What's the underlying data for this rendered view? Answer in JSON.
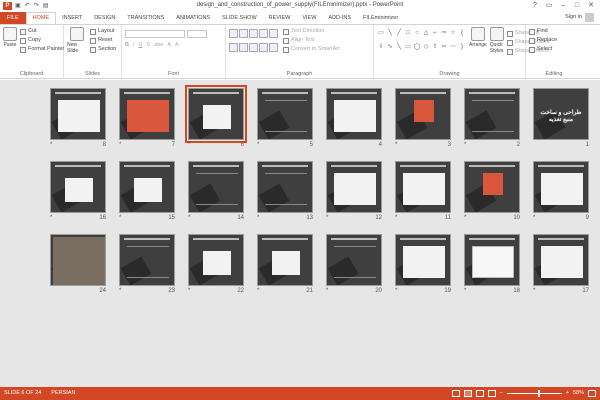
{
  "window": {
    "title": "design_and_construction_of_power_supply(FILEminimizer).pptx - PowerPoint",
    "app_icon": "P",
    "qat": [
      "save-icon",
      "undo-icon",
      "redo-icon",
      "present-icon"
    ],
    "controls": [
      "?",
      "▭",
      "–",
      "□",
      "✕"
    ],
    "signin": "Sign in"
  },
  "tabs": [
    {
      "label": "FILE"
    },
    {
      "label": "HOME"
    },
    {
      "label": "INSERT"
    },
    {
      "label": "DESIGN"
    },
    {
      "label": "TRANSITIONS"
    },
    {
      "label": "ANIMATIONS"
    },
    {
      "label": "SLIDE SHOW"
    },
    {
      "label": "REVIEW"
    },
    {
      "label": "VIEW"
    },
    {
      "label": "ADD-INS"
    },
    {
      "label": "FILEminimizer"
    }
  ],
  "active_tab": "HOME",
  "ribbon": {
    "clipboard": {
      "label": "Clipboard",
      "paste": "Paste",
      "cut": "Cut",
      "copy": "Copy",
      "format_painter": "Format Painter"
    },
    "slides": {
      "label": "Slides",
      "new_slide": "New Slide",
      "layout": "Layout",
      "reset": "Reset",
      "section": "Section"
    },
    "font": {
      "label": "Font",
      "bold": "B",
      "italic": "I",
      "underline": "U",
      "shadow": "S",
      "strike": "abe",
      "grow": "A",
      "clear": "A"
    },
    "paragraph": {
      "label": "Paragraph",
      "text_direction": "Text Direction",
      "align_text": "Align Text",
      "convert_smartart": "Convert to SmartArt"
    },
    "drawing": {
      "label": "Drawing",
      "arrange": "Arrange",
      "quick_styles": "Quick Styles",
      "shape_fill": "Shape Fill",
      "shape_outline": "Shape Outline",
      "shape_effects": "Shape Effects"
    },
    "editing": {
      "label": "Editing",
      "find": "Find",
      "replace": "Replace",
      "select": "Select"
    }
  },
  "slides": [
    {
      "num": "1",
      "star": "",
      "kind": "title",
      "title_text": "طراحی و ساخت منبع تغذیه"
    },
    {
      "num": "2",
      "star": "*",
      "kind": "dark-text"
    },
    {
      "num": "3",
      "star": "*",
      "kind": "orange-block"
    },
    {
      "num": "4",
      "star": "",
      "kind": "light-table"
    },
    {
      "num": "5",
      "star": "*",
      "kind": "dark-diagram"
    },
    {
      "num": "6",
      "star": "*",
      "kind": "light-small",
      "selected": true
    },
    {
      "num": "7",
      "star": "*",
      "kind": "orange-full"
    },
    {
      "num": "8",
      "star": "*",
      "kind": "light-table"
    },
    {
      "num": "9",
      "star": "*",
      "kind": "light-wave"
    },
    {
      "num": "10",
      "star": "*",
      "kind": "orange-block"
    },
    {
      "num": "11",
      "star": "*",
      "kind": "light-table"
    },
    {
      "num": "12",
      "star": "*",
      "kind": "light-wave"
    },
    {
      "num": "13",
      "star": "*",
      "kind": "dark-diagram"
    },
    {
      "num": "14",
      "star": "*",
      "kind": "dark-text"
    },
    {
      "num": "15",
      "star": "*",
      "kind": "light-small"
    },
    {
      "num": "16",
      "star": "*",
      "kind": "light-small"
    },
    {
      "num": "17",
      "star": "*",
      "kind": "light-table"
    },
    {
      "num": "18",
      "star": "*",
      "kind": "white-box"
    },
    {
      "num": "19",
      "star": "*",
      "kind": "light-table"
    },
    {
      "num": "20",
      "star": "*",
      "kind": "dark-diagram"
    },
    {
      "num": "21",
      "star": "*",
      "kind": "light-small"
    },
    {
      "num": "22",
      "star": "*",
      "kind": "light-small"
    },
    {
      "num": "23",
      "star": "*",
      "kind": "dark-text"
    },
    {
      "num": "24",
      "star": "",
      "kind": "photo"
    }
  ],
  "status": {
    "slide_info": "SLIDE 6 OF 24",
    "language": "PERSIAN",
    "zoom": "58%",
    "zoom_fraction": 0.58,
    "minus": "−",
    "plus": "+"
  },
  "colors": {
    "accent": "#d24726",
    "workspace": "#e6e6e6",
    "slide_bg": "#3f3f3f"
  }
}
